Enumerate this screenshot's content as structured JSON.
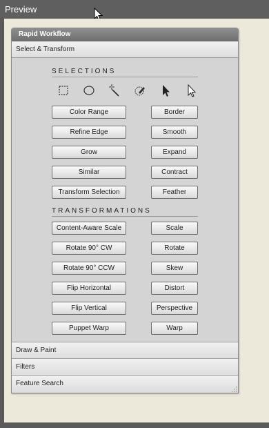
{
  "window": {
    "title": "Preview"
  },
  "panel": {
    "title": "Rapid Workflow",
    "expanded_section": "Select & Transform",
    "selections": {
      "title": "SELECTIONS",
      "tools": [
        "rect-marquee-icon",
        "ellipse-marquee-icon",
        "magic-wand-icon",
        "quick-selection-brush-icon",
        "selection-arrow-icon",
        "direct-selection-arrow-icon"
      ],
      "left_buttons": [
        "Color Range",
        "Refine Edge",
        "Grow",
        "Similar",
        "Transform Selection"
      ],
      "right_buttons": [
        "Border",
        "Smooth",
        "Expand",
        "Contract",
        "Feather"
      ]
    },
    "transformations": {
      "title": "TRANSFORMATIONS",
      "left_buttons": [
        "Content-Aware Scale",
        "Rotate 90° CW",
        "Rotate 90° CCW",
        "Flip Horizontal",
        "Flip Vertical",
        "Puppet Warp"
      ],
      "right_buttons": [
        "Scale",
        "Rotate",
        "Skew",
        "Distort",
        "Perspective",
        "Warp"
      ]
    },
    "collapsed_sections": [
      "Draw & Paint",
      "Filters",
      "Feature Search"
    ]
  },
  "colors": {
    "panel_bg": "#d4d4d4",
    "canvas_bg": "#ede9da",
    "chrome": "#5a5a5a"
  }
}
